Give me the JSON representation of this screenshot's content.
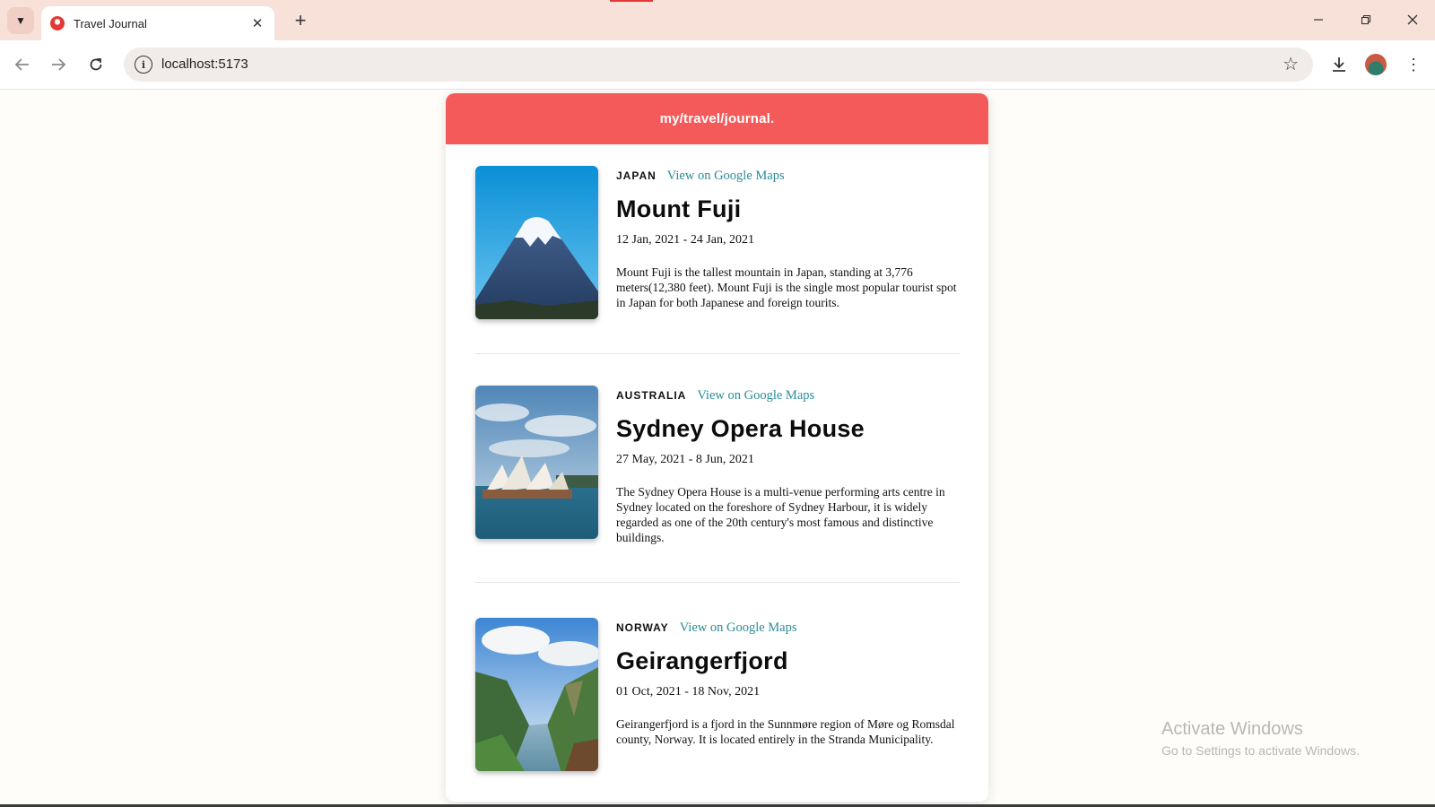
{
  "browser": {
    "tab_title": "Travel Journal",
    "url": "localhost:5173"
  },
  "app": {
    "title": "my/travel/journal."
  },
  "entries": [
    {
      "country": "JAPAN",
      "maps_link": "View on Google Maps",
      "place": "Mount Fuji",
      "dates": "12 Jan, 2021 - 24 Jan, 2021",
      "description": "Mount Fuji is the tallest mountain in Japan, standing at 3,776 meters(12,380 feet). Mount Fuji is the single most popular tourist spot in Japan for both Japanese and foreign tourits."
    },
    {
      "country": "AUSTRALIA",
      "maps_link": "View on Google Maps",
      "place": "Sydney Opera House",
      "dates": "27 May, 2021 - 8 Jun, 2021",
      "description": "The Sydney Opera House is a multi-venue performing arts centre in Sydney located on the foreshore of Sydney Harbour, it is widely regarded as one of the 20th century's most famous and distinctive buildings."
    },
    {
      "country": "NORWAY",
      "maps_link": "View on Google Maps",
      "place": "Geirangerfjord",
      "dates": "01 Oct, 2021 - 18 Nov, 2021",
      "description": "Geirangerfjord is a fjord in the Sunnmøre region of Møre og Romsdal county, Norway. It is located entirely in the Stranda Municipality."
    }
  ],
  "watermark": {
    "line1": "Activate Windows",
    "line2": "Go to Settings to activate Windows."
  },
  "icons": {
    "tab_favicon": "travel-favicon-icon",
    "tab_list": "chevron-down-icon",
    "close": "close-icon",
    "new_tab": "plus-icon",
    "back": "arrow-left-icon",
    "forward": "arrow-right-icon",
    "reload": "reload-icon",
    "site_info": "info-icon",
    "bookmark": "star-icon",
    "download": "download-icon",
    "profile": "avatar-icon",
    "menu": "kebab-menu-icon"
  },
  "colors": {
    "header_red": "#f55a5a",
    "link_teal": "#2a8c96",
    "tabstrip": "#f8e1d9"
  }
}
